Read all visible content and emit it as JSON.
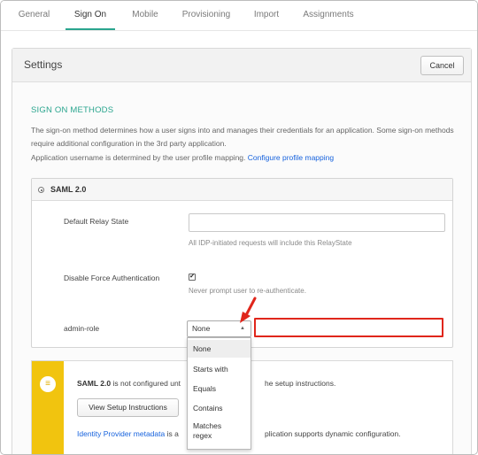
{
  "tabs": [
    {
      "label": "General"
    },
    {
      "label": "Sign On"
    },
    {
      "label": "Mobile"
    },
    {
      "label": "Provisioning"
    },
    {
      "label": "Import"
    },
    {
      "label": "Assignments"
    }
  ],
  "settings": {
    "title": "Settings",
    "cancel_label": "Cancel"
  },
  "sign_on": {
    "section_title": "SIGN ON METHODS",
    "description": "The sign-on method determines how a user signs into and manages their credentials for an application. Some sign-on methods require additional configuration in the 3rd party application.",
    "username_text": "Application username is determined by the user profile mapping.",
    "username_link": "Configure profile mapping"
  },
  "saml": {
    "label": "SAML 2.0",
    "relay_state_label": "Default Relay State",
    "relay_state_value": "",
    "relay_state_hint": "All IDP-initiated requests will include this RelayState",
    "force_auth_label": "Disable Force Authentication",
    "force_auth_checked": "✔",
    "force_auth_hint": "Never prompt user to re-authenticate.",
    "admin_role_label": "admin-role",
    "admin_role_selected": "None",
    "admin_role_value": "",
    "dropdown_options": [
      "None",
      "Starts with",
      "Equals",
      "Contains",
      "Matches regex"
    ]
  },
  "info": {
    "saml_bold": "SAML 2.0",
    "line1_a": "is not configured unt",
    "line1_b": "he setup instructions.",
    "view_button": "View Setup Instructions",
    "idp_link": "Identity Provider metadata",
    "line3_a": "is a",
    "line3_b": "plication supports dynamic configuration."
  },
  "colors": {
    "accent": "#2aa58e",
    "link": "#1662dd",
    "warning_stripe": "#f1c40f",
    "highlight_red": "#e0261b"
  }
}
